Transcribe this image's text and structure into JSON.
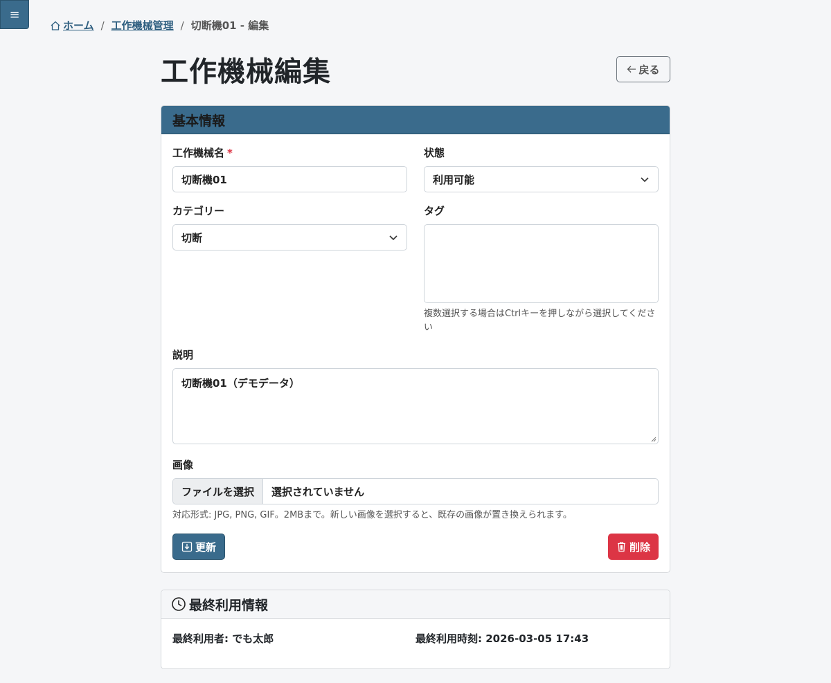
{
  "nav": {
    "menu_icon": "≡"
  },
  "breadcrumb": {
    "home": "ホーム",
    "machine_mgmt": "工作機械管理",
    "current": "切断機01 - 編集",
    "separator": "/"
  },
  "page": {
    "title": "工作機械編集",
    "back_label": "戻る"
  },
  "basic_info": {
    "header": "基本情報",
    "name_label": "工作機械名",
    "required_mark": "*",
    "name_value": "切断機01",
    "status_label": "状態",
    "status_value": "利用可能",
    "category_label": "カテゴリー",
    "category_value": "切断",
    "tag_label": "タグ",
    "tag_help": "複数選択する場合はCtrlキーを押しながら選択してください",
    "description_label": "説明",
    "description_value": "切断機01（デモデータ）",
    "image_label": "画像",
    "file_button": "ファイルを選択",
    "file_status": "選択されていません",
    "image_help": "対応形式: JPG, PNG, GIF。2MBまで。新しい画像を選択すると、既存の画像が置き換えられます。",
    "update_label": "更新",
    "delete_label": "削除"
  },
  "last_use": {
    "header": "最終利用情報",
    "user": "最終利用者: でも太郎",
    "time": "最終利用時刻: 2026-03-05 17:43"
  },
  "colors": {
    "primary": "#3a6b8c",
    "danger": "#dc3545",
    "required": "#dc3545"
  },
  "icons": [
    "menu-icon",
    "home-icon",
    "arrow-left-icon",
    "chevron-down-icon",
    "save-icon",
    "trash-icon",
    "clock-icon"
  ]
}
